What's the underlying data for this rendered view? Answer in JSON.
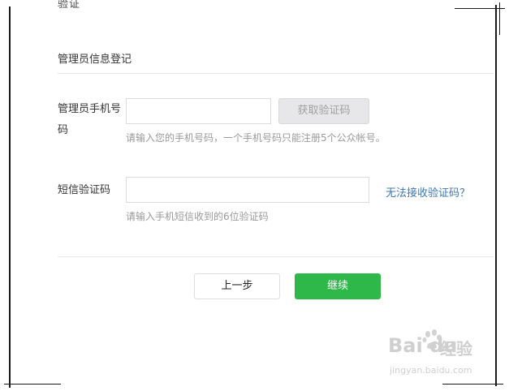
{
  "cutoff_heading": "验证",
  "section_title": "管理员信息登记",
  "phone": {
    "label": "管理员手机号码",
    "value": "",
    "placeholder": "",
    "get_code_label": "获取验证码",
    "hint": "请输入您的手机号码，一个手机号码只能注册5个公众帐号。"
  },
  "sms": {
    "label": "短信验证码",
    "value": "",
    "placeholder": "",
    "no_code_link": "无法接收验证码？",
    "hint": "请输入手机短信收到的6位验证码"
  },
  "actions": {
    "prev_label": "上一步",
    "next_label": "继续"
  },
  "watermark": {
    "logo": "Bai du",
    "brand": "经验",
    "url": "jingyan.baidu.com"
  },
  "colors": {
    "accent_green": "#2fb84a",
    "link_blue": "#3d78b4",
    "hint_gray": "#999999"
  }
}
